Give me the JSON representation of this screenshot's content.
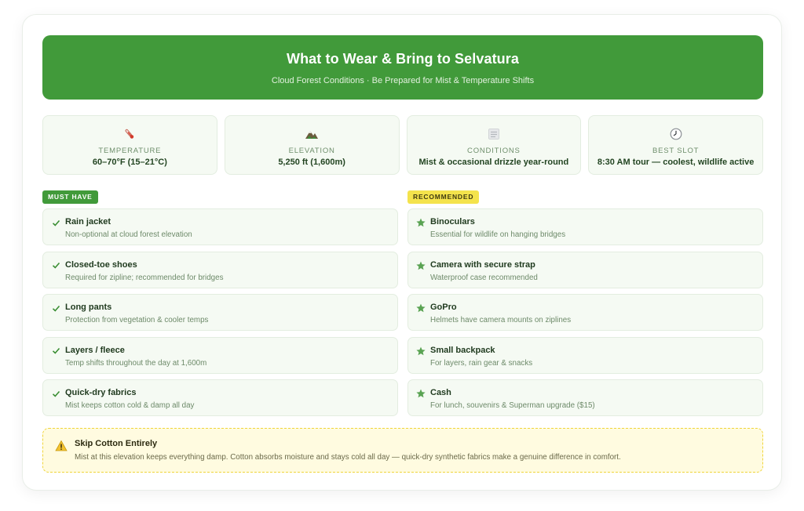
{
  "header": {
    "title": "What to Wear & Bring to Selvatura",
    "subtitle": "Cloud Forest Conditions · Be Prepared for Mist & Temperature Shifts",
    "color": "#419a3a"
  },
  "stats": [
    {
      "icon": "thermometer-icon",
      "label": "TEMPERATURE",
      "value": "60–70°F (15–21°C)"
    },
    {
      "icon": "mountain-icon",
      "label": "ELEVATION",
      "value": "5,250 ft (1,600m)"
    },
    {
      "icon": "fog-icon",
      "label": "CONDITIONS",
      "value": "Mist & occasional drizzle year-round"
    },
    {
      "icon": "clock-icon",
      "label": "BEST SLOT",
      "value": "8:30 AM tour — coolest, wildlife active"
    }
  ],
  "must_have": {
    "badge": "MUST HAVE",
    "badge_color": "#419a3a",
    "items": [
      {
        "title": "Rain jacket",
        "desc": "Non-optional at cloud forest elevation"
      },
      {
        "title": "Closed-toe shoes",
        "desc": "Required for zipline; recommended for bridges"
      },
      {
        "title": "Long pants",
        "desc": "Protection from vegetation & cooler temps"
      },
      {
        "title": "Layers / fleece",
        "desc": "Temp shifts throughout the day at 1,600m"
      },
      {
        "title": "Quick-dry fabrics",
        "desc": "Mist keeps cotton cold & damp all day"
      }
    ]
  },
  "recommended": {
    "badge": "RECOMMENDED",
    "badge_color": "#f4e34c",
    "items": [
      {
        "title": "Binoculars",
        "desc": "Essential for wildlife on hanging bridges"
      },
      {
        "title": "Camera with secure strap",
        "desc": "Waterproof case recommended"
      },
      {
        "title": "GoPro",
        "desc": "Helmets have camera mounts on ziplines"
      },
      {
        "title": "Small backpack",
        "desc": "For layers, rain gear & snacks"
      },
      {
        "title": "Cash",
        "desc": "For lunch, souvenirs & Superman upgrade ($15)"
      }
    ]
  },
  "warning": {
    "icon": "warning-icon",
    "title": "Skip Cotton Entirely",
    "text": "Mist at this elevation keeps everything damp. Cotton absorbs moisture and stays cold all day — quick-dry synthetic fabrics make a genuine difference in comfort."
  }
}
